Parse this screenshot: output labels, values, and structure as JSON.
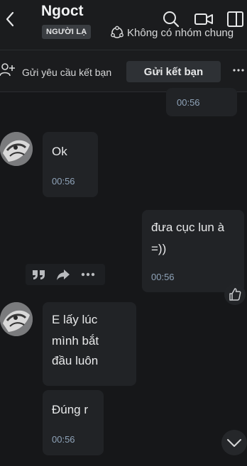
{
  "header": {
    "contact_name": "Ngoct",
    "badge": "NGƯỜI LẠ",
    "groups_text": "Không có nhóm chung"
  },
  "friend_bar": {
    "request_text": "Gửi yêu cầu kết bạn",
    "send_button": "Gửi kết bạn"
  },
  "messages": [
    {
      "time": "00:56"
    },
    {
      "text": "Ok",
      "time": "00:56"
    },
    {
      "text_lines": [
        "đưa cục lun à",
        "=))"
      ],
      "time": "00:56"
    },
    {
      "text_lines": [
        "E lấy lúc",
        "mình bắt",
        "đầu luôn"
      ]
    },
    {
      "text": "Đúng r",
      "time": "00:56"
    }
  ],
  "colors": {
    "background": "#161719",
    "bubble": "#212326",
    "time_text": "#8fa3b8",
    "badge_bg": "#3a3d41"
  },
  "icons": [
    "back-icon",
    "search-icon",
    "video-call-icon",
    "sidebar-icon",
    "groups-icon",
    "add-user-icon",
    "more-icon",
    "quote-icon",
    "forward-icon",
    "options-icon",
    "like-icon",
    "chevron-down-icon"
  ]
}
